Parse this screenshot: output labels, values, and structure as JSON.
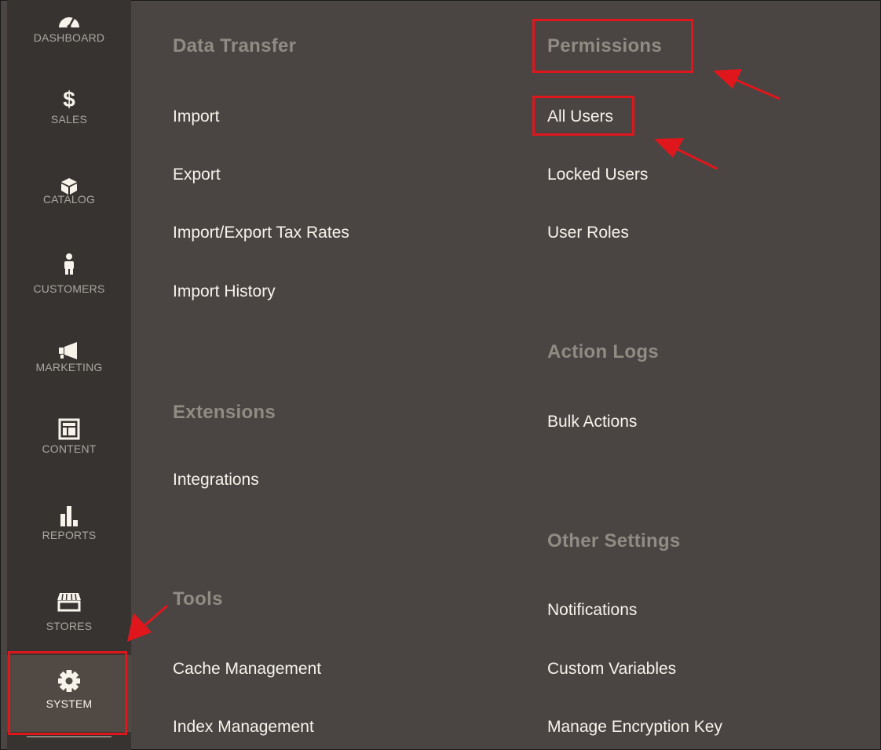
{
  "sidebar": {
    "items": [
      {
        "label": "DASHBOARD",
        "icon": "dashboard-icon"
      },
      {
        "label": "SALES",
        "icon": "dollar-icon"
      },
      {
        "label": "CATALOG",
        "icon": "cube-icon"
      },
      {
        "label": "CUSTOMERS",
        "icon": "person-icon"
      },
      {
        "label": "MARKETING",
        "icon": "megaphone-icon"
      },
      {
        "label": "CONTENT",
        "icon": "layout-icon"
      },
      {
        "label": "REPORTS",
        "icon": "bar-chart-icon"
      },
      {
        "label": "STORES",
        "icon": "storefront-icon"
      },
      {
        "label": "SYSTEM",
        "icon": "gear-icon",
        "active": true
      }
    ]
  },
  "menu": {
    "data_transfer": {
      "title": "Data Transfer",
      "links": [
        "Import",
        "Export",
        "Import/Export Tax Rates",
        "Import History"
      ]
    },
    "extensions": {
      "title": "Extensions",
      "links": [
        "Integrations"
      ]
    },
    "tools": {
      "title": "Tools",
      "links": [
        "Cache Management",
        "Index Management"
      ]
    },
    "permissions": {
      "title": "Permissions",
      "links": [
        "All Users",
        "Locked Users",
        "User Roles"
      ]
    },
    "action_logs": {
      "title": "Action Logs",
      "links": [
        "Bulk Actions"
      ]
    },
    "other_settings": {
      "title": "Other Settings",
      "links": [
        "Notifications",
        "Custom Variables",
        "Manage Encryption Key"
      ]
    }
  },
  "colors": {
    "panel_bg": "#4a4542",
    "sidebar_bg": "#373330",
    "annotation_red": "#e0161d",
    "group_title": "#928b84",
    "link_text": "#f7f3eb"
  }
}
